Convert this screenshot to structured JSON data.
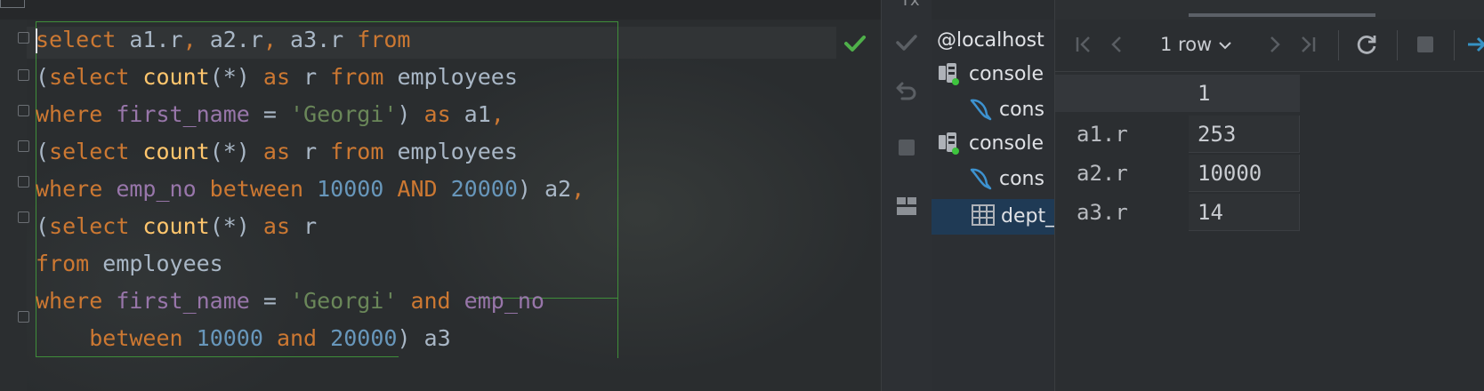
{
  "editor": {
    "status": "check-icon",
    "lines": [
      [
        [
          "kw",
          "select"
        ],
        [
          "txt",
          " a1.r"
        ],
        [
          "kw",
          ","
        ],
        [
          "txt",
          " a2.r"
        ],
        [
          "kw",
          ","
        ],
        [
          "txt",
          " a3.r "
        ],
        [
          "kw",
          "from"
        ]
      ],
      [
        [
          "txt",
          "("
        ],
        [
          "kw",
          "select "
        ],
        [
          "fn",
          "count"
        ],
        [
          "txt",
          "(*) "
        ],
        [
          "kw",
          "as"
        ],
        [
          "txt",
          " r "
        ],
        [
          "kw",
          "from"
        ],
        [
          "txt",
          " employees"
        ]
      ],
      [
        [
          "kw",
          "where "
        ],
        [
          "col",
          "first_name"
        ],
        [
          "txt",
          " = "
        ],
        [
          "str",
          "'Georgi'"
        ],
        [
          "txt",
          ") "
        ],
        [
          "kw",
          "as"
        ],
        [
          "txt",
          " a1"
        ],
        [
          "kw",
          ","
        ]
      ],
      [
        [
          "txt",
          "("
        ],
        [
          "kw",
          "select "
        ],
        [
          "fn",
          "count"
        ],
        [
          "txt",
          "(*) "
        ],
        [
          "kw",
          "as"
        ],
        [
          "txt",
          " r "
        ],
        [
          "kw",
          "from"
        ],
        [
          "txt",
          " employees"
        ]
      ],
      [
        [
          "kw",
          "where "
        ],
        [
          "col",
          "emp_no"
        ],
        [
          "kw",
          " between "
        ],
        [
          "num",
          "10000"
        ],
        [
          "kw",
          " AND "
        ],
        [
          "num",
          "20000"
        ],
        [
          "txt",
          ") a2"
        ],
        [
          "kw",
          ","
        ]
      ],
      [
        [
          "txt",
          "("
        ],
        [
          "kw",
          "select "
        ],
        [
          "fn",
          "count"
        ],
        [
          "txt",
          "(*) "
        ],
        [
          "kw",
          "as"
        ],
        [
          "txt",
          " r"
        ]
      ],
      [
        [
          "kw",
          "from"
        ],
        [
          "txt",
          " employees"
        ]
      ],
      [
        [
          "kw",
          "where "
        ],
        [
          "col",
          "first_name"
        ],
        [
          "txt",
          " = "
        ],
        [
          "str",
          "'Georgi'"
        ],
        [
          "kw",
          " and "
        ],
        [
          "col",
          "emp_no"
        ]
      ],
      [
        [
          "txt",
          "    "
        ],
        [
          "kw",
          "between "
        ],
        [
          "num",
          "10000"
        ],
        [
          "kw",
          " and "
        ],
        [
          "num",
          "20000"
        ],
        [
          "txt",
          ") a3"
        ]
      ]
    ]
  },
  "toolstrip": {
    "tx_label": "Tx",
    "icons": [
      "commit-check-icon",
      "rollback-icon",
      "stop-icon",
      "layout-icon"
    ]
  },
  "explorer": {
    "items": [
      {
        "label": "@localhost",
        "icon": "",
        "indent": 0
      },
      {
        "label": "console",
        "icon": "console-db-icon",
        "indent": 1
      },
      {
        "label": "cons",
        "icon": "mysql-dolphin-icon",
        "indent": 2
      },
      {
        "label": "console",
        "icon": "console-db-icon",
        "indent": 1
      },
      {
        "label": "cons",
        "icon": "mysql-dolphin-icon",
        "indent": 2
      },
      {
        "label": "dept_",
        "icon": "table-icon",
        "indent": 2,
        "selected": true
      }
    ]
  },
  "results": {
    "rows_label": "1 row",
    "toolbar_icons": [
      "first-page-icon",
      "prev-page-icon",
      "next-page-icon",
      "last-page-icon",
      "refresh-icon",
      "stop-icon",
      "arrow-right-icon"
    ],
    "column_header": "1",
    "rows": [
      {
        "name": "a1.r",
        "value": "253"
      },
      {
        "name": "a2.r",
        "value": "10000"
      },
      {
        "name": "a3.r",
        "value": "14"
      }
    ]
  }
}
